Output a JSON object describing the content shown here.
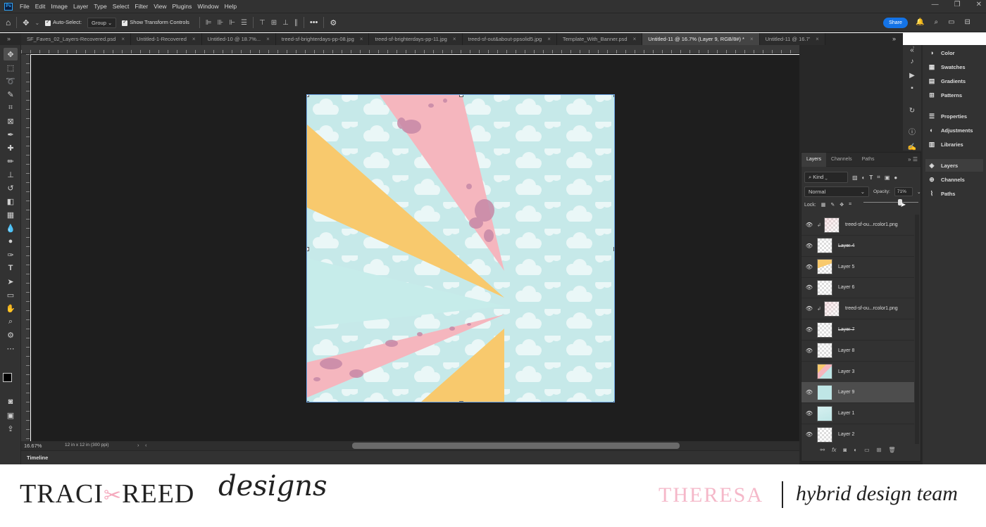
{
  "app": {
    "logo": "Ps"
  },
  "menu": [
    "File",
    "Edit",
    "Image",
    "Layer",
    "Type",
    "Select",
    "Filter",
    "View",
    "Plugins",
    "Window",
    "Help"
  ],
  "options": {
    "auto_select_label": "Auto-Select:",
    "auto_select_value": "Group",
    "transform_label": "Show Transform Controls",
    "share_label": "Share"
  },
  "tabs": [
    {
      "label": "SF_Faves_02_Layers-Recovered.psd",
      "active": false
    },
    {
      "label": "Untitled-1-Recovered",
      "active": false
    },
    {
      "label": "Untitled-10 @ 18.7%...",
      "active": false
    },
    {
      "label": "treed-sf-brighterdays-pp-08.jpg",
      "active": false
    },
    {
      "label": "treed-sf-brighterdays-pp-11.jpg",
      "active": false
    },
    {
      "label": "treed-sf-out&about-ppsolid5.jpg",
      "active": false
    },
    {
      "label": "Template_With_Banner.psd",
      "active": false
    },
    {
      "label": "Untitled-11 @ 16.7% (Layer 9, RGB/8#) *",
      "active": true
    },
    {
      "label": "Untitled-11 @ 16.7'",
      "active": false
    }
  ],
  "status": {
    "zoom": "16.67%",
    "doc_size": "12 in x 12 in (300 ppi)"
  },
  "timeline_label": "Timeline",
  "dock_panels": [
    {
      "label": "Color",
      "icon": "color-icon"
    },
    {
      "label": "Swatches",
      "icon": "swatches-icon"
    },
    {
      "label": "Gradients",
      "icon": "gradients-icon"
    },
    {
      "label": "Patterns",
      "icon": "patterns-icon"
    },
    {
      "label": "Properties",
      "icon": "properties-icon"
    },
    {
      "label": "Adjustments",
      "icon": "adjustments-icon"
    },
    {
      "label": "Libraries",
      "icon": "libraries-icon"
    },
    {
      "label": "Layers",
      "icon": "layers-icon"
    },
    {
      "label": "Channels",
      "icon": "channels-icon"
    },
    {
      "label": "Paths",
      "icon": "paths-icon"
    }
  ],
  "layers_panel": {
    "tabs": [
      "Layers",
      "Channels",
      "Paths"
    ],
    "kind_label": "Kind",
    "blend_mode": "Normal",
    "opacity_label": "Opacity:",
    "opacity_value": "71%",
    "lock_label": "Lock:",
    "layers": [
      {
        "name": "treed-sf-ou...rcolor1.png",
        "visible": true,
        "clipped": true,
        "struck": false,
        "selected": false,
        "thumb": "checker-pink"
      },
      {
        "name": "Layer 4",
        "visible": true,
        "clipped": false,
        "struck": true,
        "selected": false,
        "thumb": "checker"
      },
      {
        "name": "Layer 5",
        "visible": true,
        "clipped": false,
        "struck": false,
        "selected": false,
        "thumb": "yellow"
      },
      {
        "name": "Layer 6",
        "visible": true,
        "clipped": false,
        "struck": false,
        "selected": false,
        "thumb": "checker"
      },
      {
        "name": "treed-sf-ou...rcolor1.png",
        "visible": true,
        "clipped": true,
        "struck": false,
        "selected": false,
        "thumb": "checker-pink"
      },
      {
        "name": "Layer 7",
        "visible": true,
        "clipped": false,
        "struck": true,
        "selected": false,
        "thumb": "checker"
      },
      {
        "name": "Layer 8",
        "visible": true,
        "clipped": false,
        "struck": false,
        "selected": false,
        "thumb": "checker"
      },
      {
        "name": "Layer 3",
        "visible": false,
        "clipped": false,
        "struck": false,
        "selected": false,
        "thumb": "rays"
      },
      {
        "name": "Layer 9",
        "visible": true,
        "clipped": false,
        "struck": false,
        "selected": true,
        "thumb": "clouds"
      },
      {
        "name": "Layer 1",
        "visible": true,
        "clipped": false,
        "struck": false,
        "selected": false,
        "thumb": "teal"
      },
      {
        "name": "Layer 2",
        "visible": true,
        "clipped": false,
        "struck": false,
        "selected": false,
        "thumb": "checker"
      }
    ]
  },
  "branding": {
    "brand_left": "TRACI",
    "brand_right": "REED",
    "brand_script": "designs",
    "member": "THERESA",
    "team": "hybrid design team"
  },
  "colors": {
    "share": "#1473e6",
    "sky": "#bfe6e6",
    "yellow": "#f8c96d",
    "pink": "#f5b6be",
    "name_pink": "#f5b8c9"
  }
}
